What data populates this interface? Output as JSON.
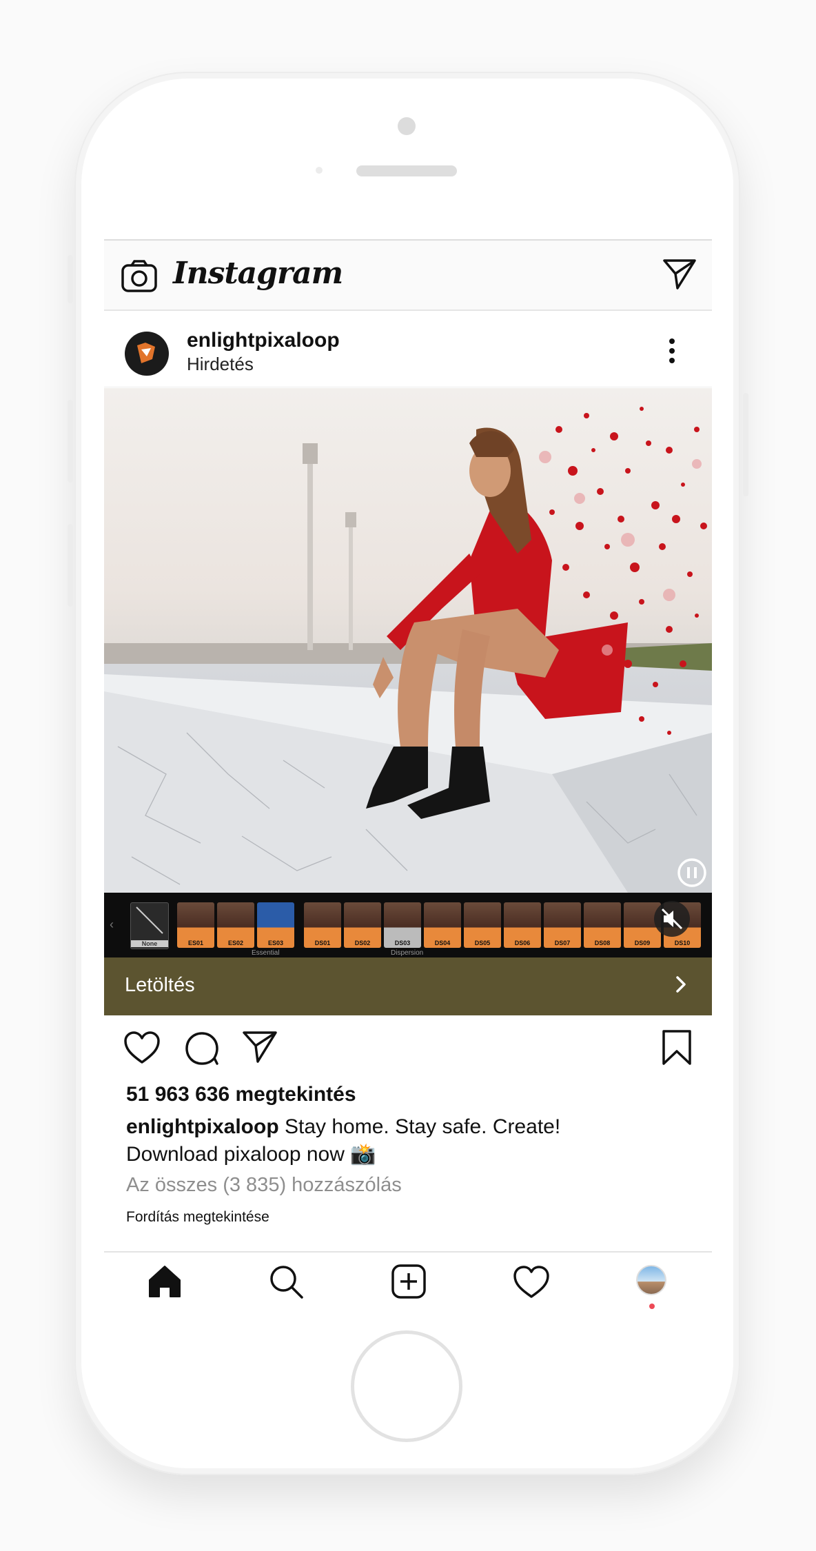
{
  "app": {
    "title": "Instagram"
  },
  "post": {
    "username": "enlightpixaloop",
    "sponsored_label": "Hirdetés",
    "cta_label": "Letöltés",
    "views": "51 963 636 megtekintés",
    "caption_user": "enlightpixaloop",
    "caption_text_line1": " Stay home. Stay safe. Create!",
    "caption_text_line2": "Download pixaloop now 📸",
    "comments_link": "Az összes (3 835) hozzászólás",
    "translate_link": "Fordítás megtekintése"
  },
  "filmstrip": {
    "thumbs": [
      "None",
      "ES01",
      "ES02",
      "ES03",
      "DS01",
      "DS02",
      "DS03",
      "DS04",
      "DS05",
      "DS06",
      "DS07",
      "DS08",
      "DS09",
      "DS10"
    ],
    "groups": [
      "Essential",
      "Dispersion"
    ]
  },
  "colors": {
    "cta_bg": "#5c5430",
    "dress": "#c8141c",
    "accent_dot": "#ed4956"
  },
  "icons": [
    "camera-icon",
    "direct-message-icon",
    "more-options-icon",
    "pause-icon",
    "mute-icon",
    "chevron-right-icon",
    "like-icon",
    "comment-icon",
    "share-icon",
    "bookmark-icon",
    "home-icon",
    "search-icon",
    "new-post-icon",
    "activity-icon",
    "profile-icon"
  ]
}
